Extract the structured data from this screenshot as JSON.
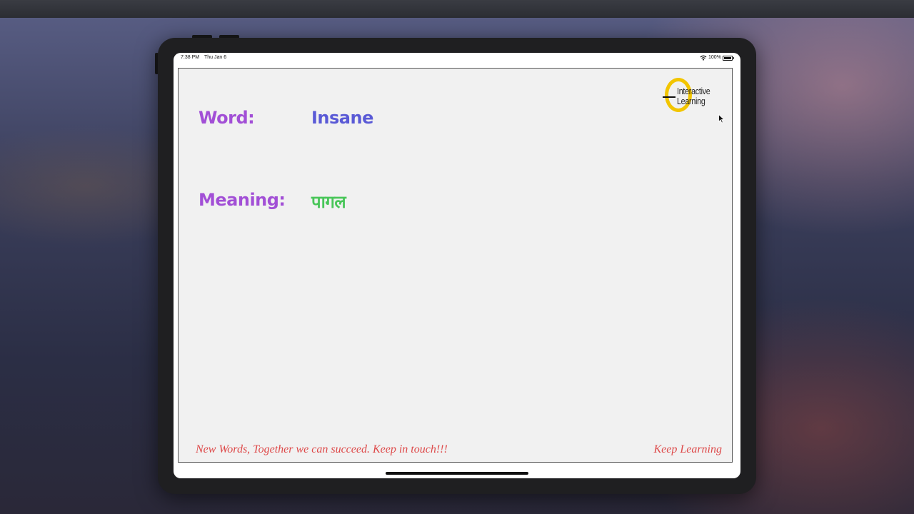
{
  "status_bar": {
    "time": "7:38 PM",
    "date": "Thu Jan 6",
    "battery": "100%",
    "icons": [
      "wifi-icon",
      "battery-icon"
    ]
  },
  "card": {
    "word_label": "Word:",
    "word_value": "Insane",
    "meaning_label": "Meaning:",
    "meaning_value": "पागल",
    "logo_text_line1": "Interactive",
    "logo_text_line2": "Learning",
    "footer_left": "New Words, Together we can succeed. Keep in touch!!!",
    "footer_right": "Keep Learning"
  },
  "colors": {
    "label": "#a24fd6",
    "word": "#5a5ad6",
    "meaning": "#49c659",
    "footer": "#de4a4a",
    "logo_ring": "#f2c500"
  }
}
